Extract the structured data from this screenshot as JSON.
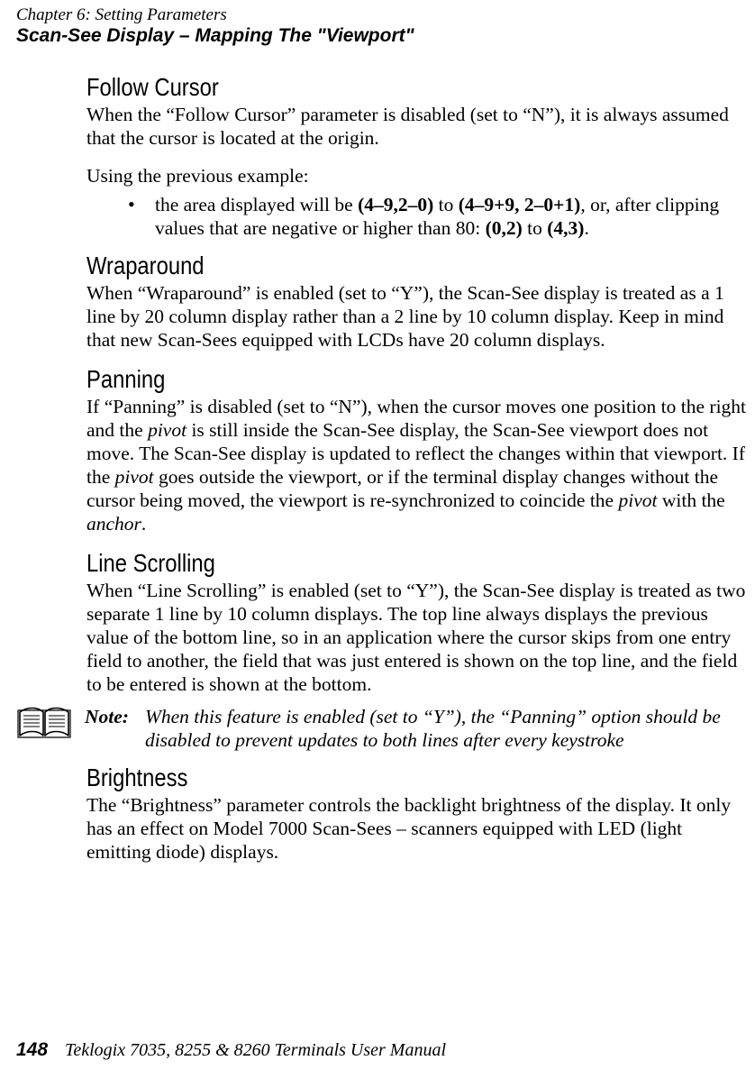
{
  "running_head": {
    "chapter": "Chapter 6: Setting Parameters",
    "section": "Scan-See Display – Mapping The \"Viewport\""
  },
  "sections": {
    "follow_cursor": {
      "title": "Follow Cursor",
      "p1_a": "When the “Follow Cursor” parameter is disabled (set to “N”), it is always assumed that the cursor is located at the origin.",
      "p2": "Using the previous example:",
      "bullet_a": "the area displayed will be ",
      "bullet_b1": "(4–9,2–0)",
      "bullet_c": " to ",
      "bullet_b2": "(4–9+9, 2–0+1)",
      "bullet_d": ", or, after clipping values that are negative or higher than 80: ",
      "bullet_b3": "(0,2)",
      "bullet_e": " to ",
      "bullet_b4": "(4,3)",
      "bullet_f": "."
    },
    "wraparound": {
      "title": "Wraparound",
      "p1": "When “Wraparound” is enabled (set to “Y”), the Scan-See display is treated as a 1 line by 20 column display rather than a 2 line by 10 column display. Keep in mind that new Scan-Sees equipped with LCDs have 20 column displays."
    },
    "panning": {
      "title": "Panning",
      "p1_a": "If “Panning” is disabled (set to “N”), when the cursor moves one position to the right and the ",
      "p1_i1": " pivot ",
      "p1_b": " is still inside the Scan-See display, the Scan-See viewport does not move. The Scan-See display is updated to reflect the changes within that viewport. If the ",
      "p1_i2": " pivot ",
      "p1_c": " goes outside the viewport, or if the terminal display changes without the cursor being moved, the viewport is re-synchronized to coincide the ",
      "p1_i3": " pivot ",
      "p1_d": " with the ",
      "p1_i4": " anchor",
      "p1_e": "."
    },
    "line_scrolling": {
      "title": "Line Scrolling",
      "p1": "When “Line Scrolling” is enabled (set to “Y”), the Scan-See display is treated as two separate 1 line by 10 column displays. The top line always displays the previous value of the bottom line, so in an application where the cursor skips from one entry field to another, the field that was just entered is shown on the top line, and the field to be entered is shown at the bottom."
    },
    "note": {
      "label": "Note:",
      "text": "When this feature is enabled (set to “Y”), the “Panning” option should be disabled to prevent updates to both lines after every keystroke"
    },
    "brightness": {
      "title": "Brightness",
      "p1": "The “Brightness” parameter controls the backlight brightness of the display. It only has an effect on Model 7000 Scan-Sees – scanners equipped with LED (light emitting diode) displays."
    }
  },
  "footer": {
    "page_number": "148",
    "manual_title": "Teklogix 7035, 8255 & 8260 Terminals User Manual"
  }
}
